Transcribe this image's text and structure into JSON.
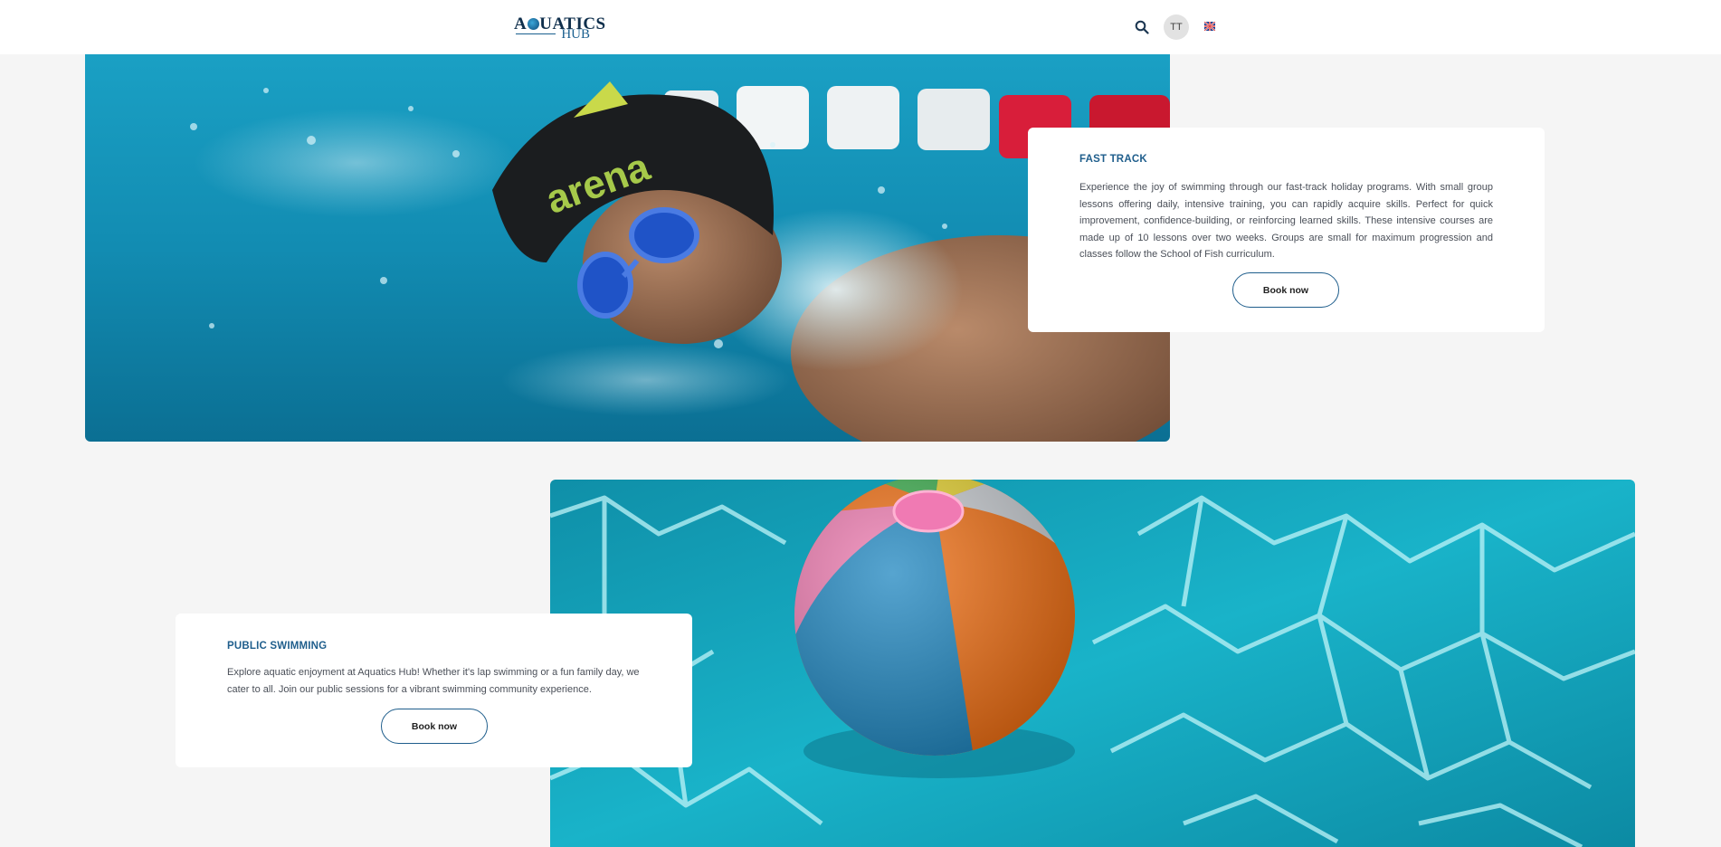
{
  "header": {
    "logo_top_a": "A",
    "logo_top_rest": "UATICS",
    "logo_bottom": "HUB",
    "avatar_initials": "TT",
    "icons": {
      "search": "search-icon",
      "flag": "uk-flag-icon"
    }
  },
  "sections": [
    {
      "title": "FAST TRACK",
      "body": "Experience the joy of swimming through our fast-track holiday programs. With small group lessons offering daily, intensive training, you can rapidly acquire skills. Perfect for quick improvement, confidence-building, or reinforcing learned skills. These intensive courses are made up of 10 lessons over two weeks. Groups are small for maximum progression and classes follow the School of Fish curriculum.",
      "button": "Book now"
    },
    {
      "title": "PUBLIC SWIMMING",
      "body": "Explore aquatic enjoyment at Aquatics Hub! Whether it's lap swimming or a fun family day, we cater to all. Join our public sessions for a vibrant swimming community experience.",
      "button": "Book now"
    }
  ],
  "colors": {
    "accent": "#1f5e8c",
    "background": "#f5f5f5",
    "pool": "#1aa3c4"
  }
}
